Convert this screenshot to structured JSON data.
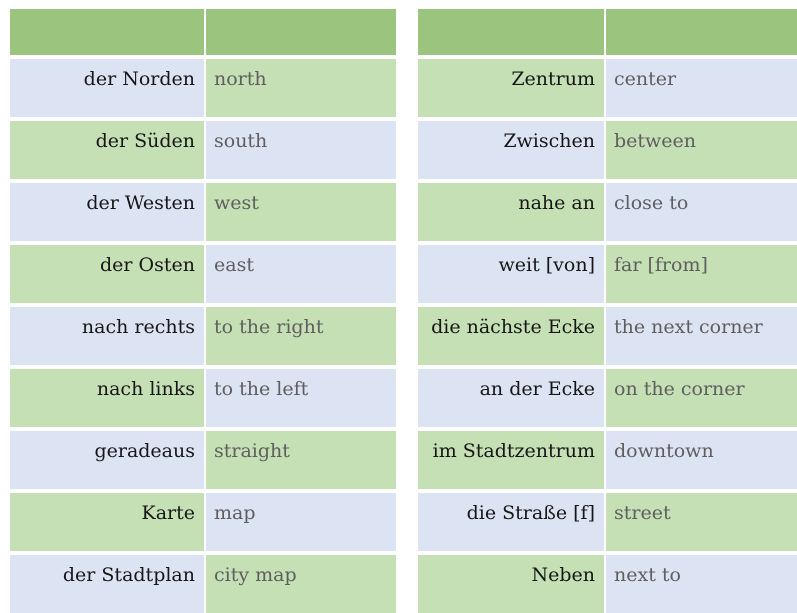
{
  "page": {
    "title": "German Directions Vocabulary Table",
    "colors": {
      "header_green": "#9bc57f",
      "cell_green": "#c5e0b4",
      "cell_blue": "#dce3f2",
      "term_text": "#161616",
      "translation_text": "#5e5e5e",
      "background": "#ffffff"
    }
  },
  "tables": [
    {
      "id": "left-table",
      "header": {
        "term_label": "",
        "translation_label": ""
      },
      "rows": [
        {
          "term": "der Norden",
          "translation": "north",
          "term_bg": "blue",
          "translation_bg": "green"
        },
        {
          "term": "der Süden",
          "translation": "south",
          "term_bg": "green",
          "translation_bg": "blue"
        },
        {
          "term": "der Westen",
          "translation": "west",
          "term_bg": "blue",
          "translation_bg": "green"
        },
        {
          "term": "der Osten",
          "translation": "east",
          "term_bg": "green",
          "translation_bg": "blue"
        },
        {
          "term": "nach rechts",
          "translation": "to the right",
          "term_bg": "blue",
          "translation_bg": "green"
        },
        {
          "term": "nach links",
          "translation": "to the left",
          "term_bg": "green",
          "translation_bg": "blue"
        },
        {
          "term": "geradeaus",
          "translation": "straight",
          "term_bg": "blue",
          "translation_bg": "green"
        },
        {
          "term": "Karte",
          "translation": "map",
          "term_bg": "green",
          "translation_bg": "blue"
        },
        {
          "term": "der Stadtplan",
          "translation": "city map",
          "term_bg": "blue",
          "translation_bg": "green"
        }
      ]
    },
    {
      "id": "right-table",
      "header": {
        "term_label": "",
        "translation_label": ""
      },
      "rows": [
        {
          "term": "Zentrum",
          "translation": "center",
          "term_bg": "green",
          "translation_bg": "blue"
        },
        {
          "term": "Zwischen",
          "translation": "between",
          "term_bg": "blue",
          "translation_bg": "green"
        },
        {
          "term": "nahe an",
          "translation": "close to",
          "term_bg": "green",
          "translation_bg": "blue"
        },
        {
          "term": "weit [von]",
          "translation": "far [from]",
          "term_bg": "blue",
          "translation_bg": "green"
        },
        {
          "term": "die nächste Ecke",
          "translation": "the next corner",
          "term_bg": "green",
          "translation_bg": "blue"
        },
        {
          "term": "an der Ecke",
          "translation": "on the corner",
          "term_bg": "blue",
          "translation_bg": "green"
        },
        {
          "term": "im Stadtzentrum",
          "translation": "downtown",
          "term_bg": "green",
          "translation_bg": "blue"
        },
        {
          "term": "die Straße [f]",
          "translation": "street",
          "term_bg": "blue",
          "translation_bg": "green"
        },
        {
          "term": "Neben",
          "translation": "next to",
          "term_bg": "green",
          "translation_bg": "blue"
        }
      ]
    }
  ]
}
